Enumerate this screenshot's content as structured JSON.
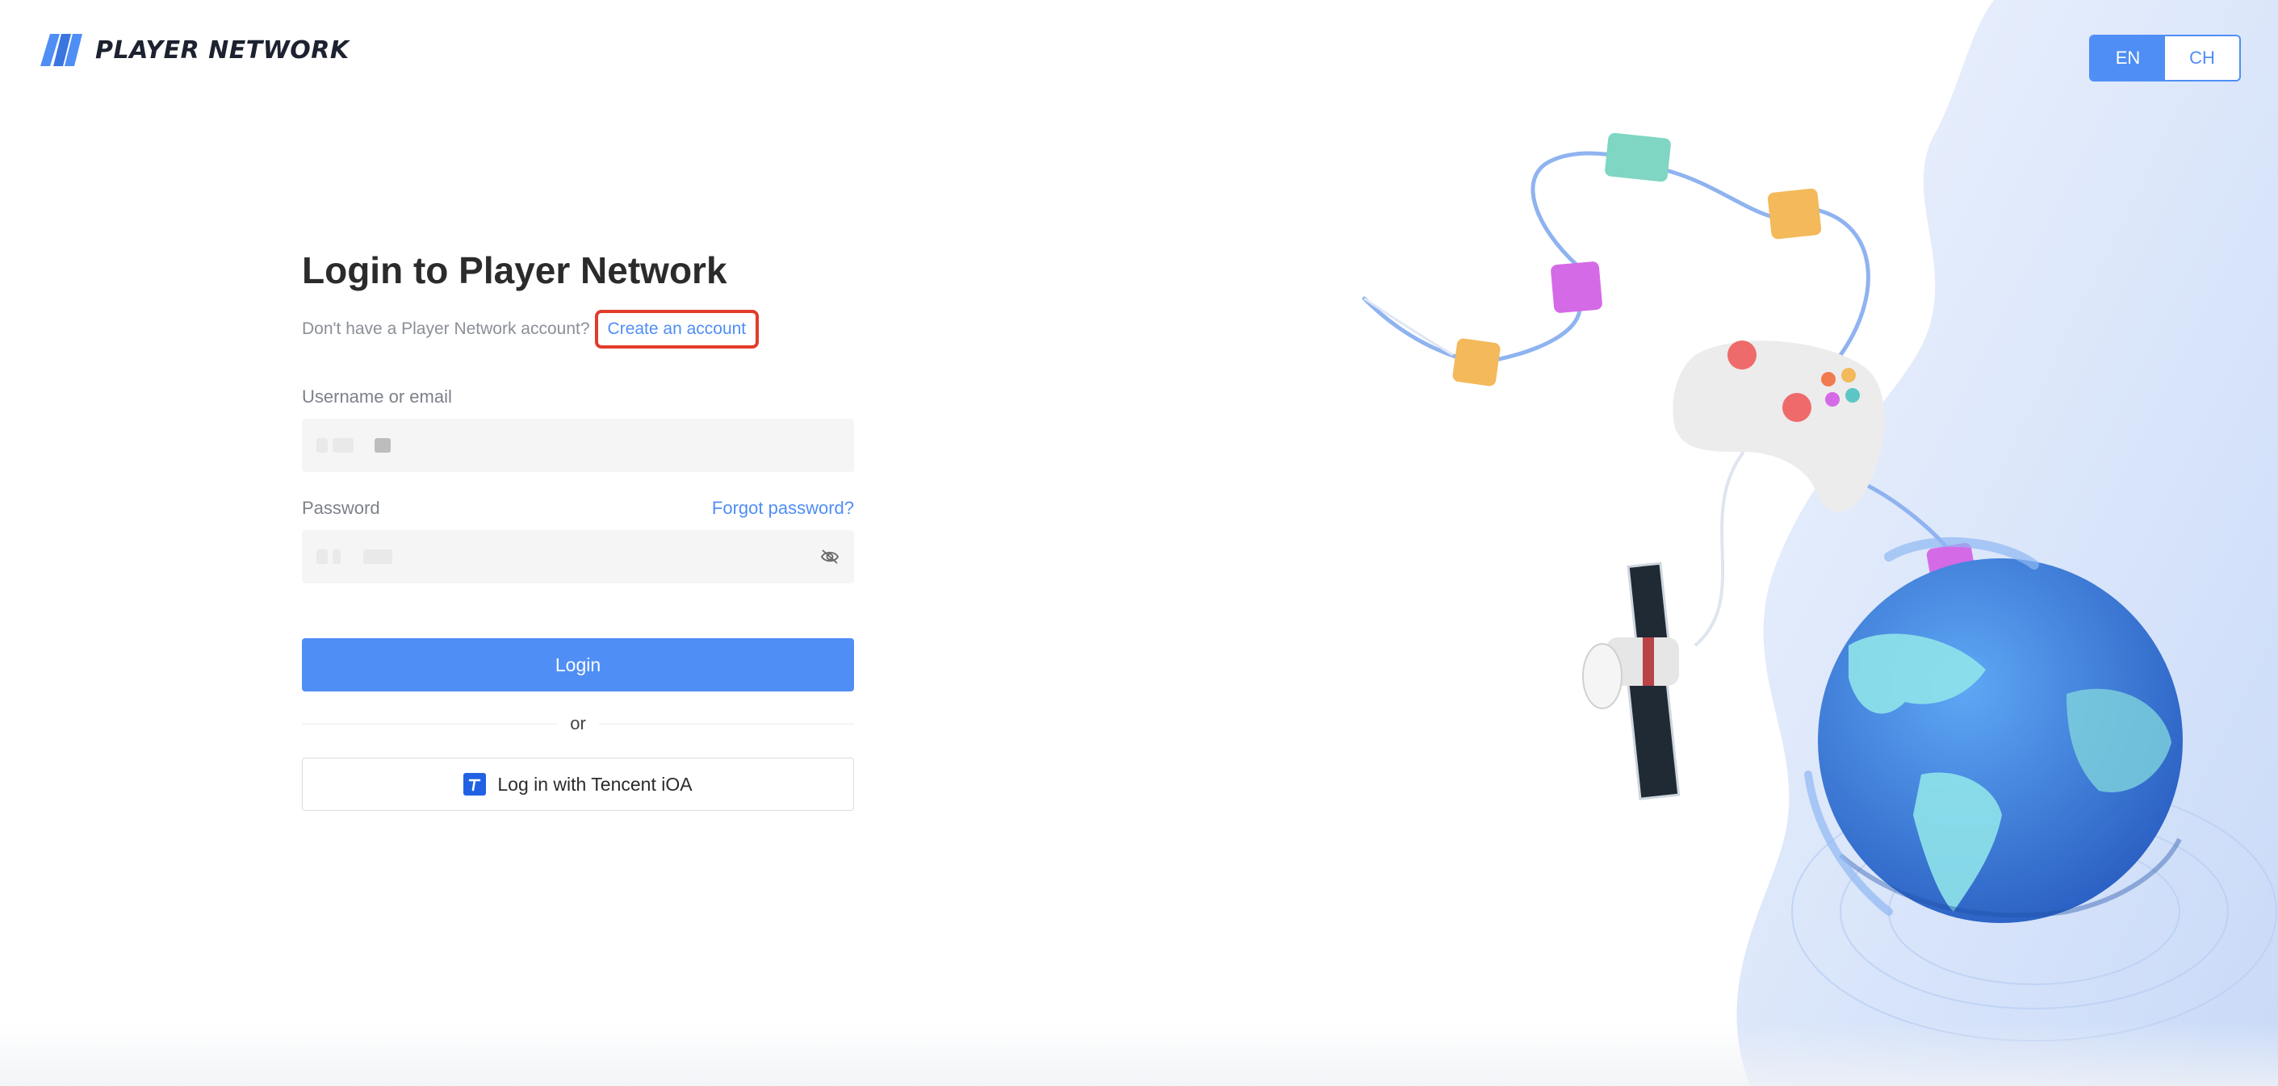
{
  "brand": {
    "name": "PLAYER NETWORK",
    "accent": "#4f8ef5"
  },
  "language": {
    "options": [
      "EN",
      "CH"
    ],
    "selected": "EN"
  },
  "login": {
    "title": "Login to Player Network",
    "no_account_text": "Don't have a Player Network account?",
    "create_account_link": "Create an account",
    "username_label": "Username or email",
    "password_label": "Password",
    "forgot_password_link": "Forgot password?",
    "login_button": "Login",
    "divider_text": "or",
    "tencent_login_button": "Log in with Tencent iOA"
  },
  "icons": [
    "player-network-logo-icon",
    "eye-slash-icon",
    "tencent-ioa-icon"
  ],
  "colors": {
    "primary": "#4f8ef5",
    "highlight_border": "#e23b2a",
    "panel_bg": "#dce7fb"
  }
}
